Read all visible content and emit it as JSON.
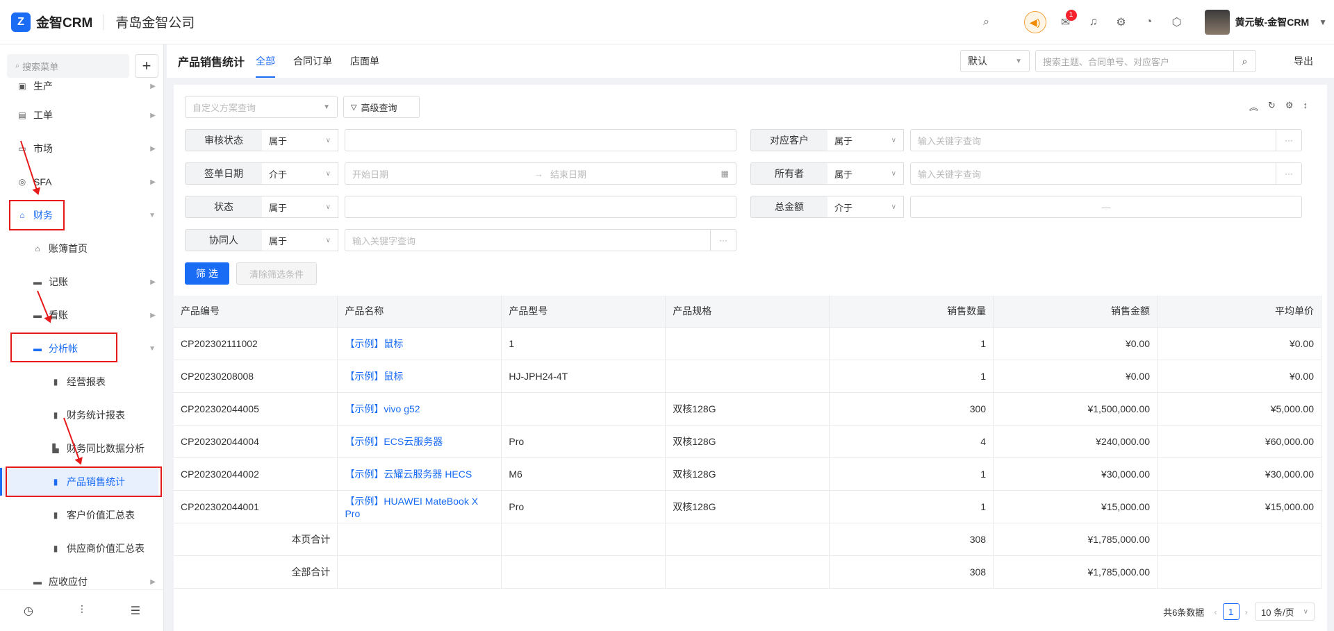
{
  "app": {
    "name": "金智CRM",
    "logo_letter": "Z",
    "company": "青岛金智公司",
    "notif_count": "1",
    "user": "黄元敏-金智CRM"
  },
  "sidebar": {
    "search_placeholder": "搜索菜单",
    "items": [
      {
        "label": "生产",
        "icon": "production-icon"
      },
      {
        "label": "工单",
        "icon": "workorder-icon"
      },
      {
        "label": "市场",
        "icon": "market-icon"
      },
      {
        "label": "SFA",
        "icon": "sfa-icon"
      },
      {
        "label": "财务",
        "icon": "finance-icon"
      },
      {
        "label": "账簿首页",
        "icon": "home-icon"
      },
      {
        "label": "记账",
        "icon": "folder-icon"
      },
      {
        "label": "看账",
        "icon": "folder-icon"
      },
      {
        "label": "分析帐",
        "icon": "folder-icon"
      },
      {
        "label": "经营报表",
        "icon": "file-icon"
      },
      {
        "label": "财务统计报表",
        "icon": "file-icon"
      },
      {
        "label": "财务同比数据分析",
        "icon": "bar-chart-icon"
      },
      {
        "label": "产品销售统计",
        "icon": "file-icon"
      },
      {
        "label": "客户价值汇总表",
        "icon": "file-icon"
      },
      {
        "label": "供应商价值汇总表",
        "icon": "file-icon"
      },
      {
        "label": "应收应付",
        "icon": "folder-icon"
      }
    ]
  },
  "header": {
    "title": "产品销售统计",
    "tabs": [
      "全部",
      "合同订单",
      "店面单"
    ],
    "view_select": "默认",
    "search_placeholder": "搜索主题、合同单号、对应客户",
    "export": "导出"
  },
  "filters": {
    "scheme_placeholder": "自定义方案查询",
    "advanced": "高级查询",
    "rows": [
      {
        "label": "审核状态",
        "op": "属于",
        "placeholder": ""
      },
      {
        "label": "签单日期",
        "op": "介于",
        "start": "开始日期",
        "end": "结束日期"
      },
      {
        "label": "状态",
        "op": "属于",
        "placeholder": ""
      },
      {
        "label": "协同人",
        "op": "属于",
        "placeholder": "输入关键字查询"
      },
      {
        "label": "对应客户",
        "op": "属于",
        "placeholder": "输入关键字查询"
      },
      {
        "label": "所有者",
        "op": "属于",
        "placeholder": "输入关键字查询"
      },
      {
        "label": "总金额",
        "op": "介于",
        "placeholder": "—"
      }
    ],
    "filter_btn": "筛 选",
    "clear_btn": "清除筛选条件"
  },
  "table": {
    "columns": [
      "产品编号",
      "产品名称",
      "产品型号",
      "产品规格",
      "销售数量",
      "销售金额",
      "平均单价"
    ],
    "rows": [
      [
        "CP202302111002",
        "【示例】鼠标",
        "1",
        "",
        "1",
        "¥0.00",
        "¥0.00"
      ],
      [
        "CP20230208008",
        "【示例】鼠标",
        "HJ-JPH24-4T",
        "",
        "1",
        "¥0.00",
        "¥0.00"
      ],
      [
        "CP202302044005",
        "【示例】vivo g52",
        "",
        "双核128G",
        "300",
        "¥1,500,000.00",
        "¥5,000.00"
      ],
      [
        "CP202302044004",
        "【示例】ECS云服务器",
        "Pro",
        "双核128G",
        "4",
        "¥240,000.00",
        "¥60,000.00"
      ],
      [
        "CP202302044002",
        "【示例】云耀云服务器 HECS",
        "M6",
        "双核128G",
        "1",
        "¥30,000.00",
        "¥30,000.00"
      ],
      [
        "CP202302044001",
        "【示例】HUAWEI MateBook X Pro",
        "Pro",
        "双核128G",
        "1",
        "¥15,000.00",
        "¥15,000.00"
      ]
    ],
    "page_total": {
      "label": "本页合计",
      "qty": "308",
      "amount": "¥1,785,000.00"
    },
    "all_total": {
      "label": "全部合计",
      "qty": "308",
      "amount": "¥1,785,000.00"
    }
  },
  "pager": {
    "total": "共6条数据",
    "current": "1",
    "size": "10 条/页"
  }
}
